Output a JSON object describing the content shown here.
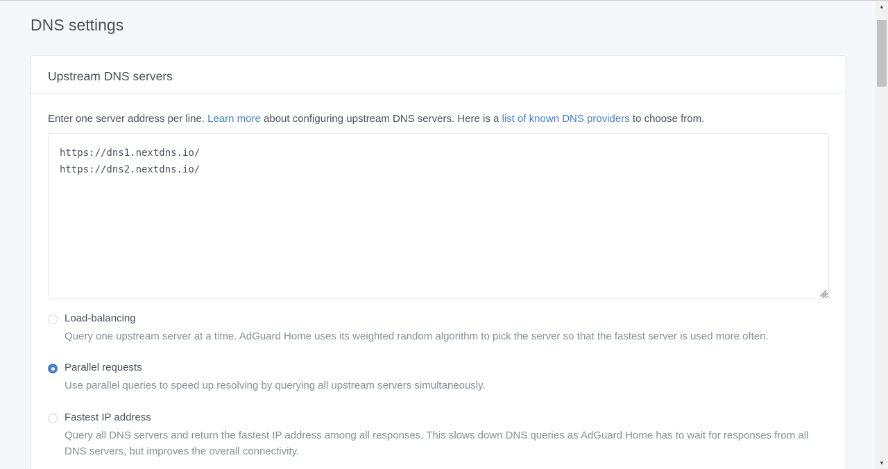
{
  "page": {
    "title": "DNS settings"
  },
  "card": {
    "title": "Upstream DNS servers",
    "description": {
      "before": "Enter one server address per line. ",
      "link1": "Learn more",
      "middle": " about configuring upstream DNS servers. Here is a ",
      "link2": "list of known DNS providers",
      "after": " to choose from."
    },
    "upstreams_value": "https://dns1.nextdns.io/\nhttps://dns2.nextdns.io/",
    "options": [
      {
        "label": "Load-balancing",
        "description": "Query one upstream server at a time. AdGuard Home uses its weighted random algorithm to pick the server so that the fastest server is used more often.",
        "checked": false
      },
      {
        "label": "Parallel requests",
        "description": "Use parallel queries to speed up resolving by querying all upstream servers simultaneously.",
        "checked": true
      },
      {
        "label": "Fastest IP address",
        "description": "Query all DNS servers and return the fastest IP address among all responses. This slows down DNS queries as AdGuard Home has to wait for responses from all DNS servers, but improves the overall connectivity.",
        "checked": false
      }
    ]
  },
  "colors": {
    "link": "#467fcf",
    "radio_checked": "#467fcf",
    "muted_text": "#868e96"
  },
  "icons": {
    "scroll_up": "scroll-up-arrow-icon",
    "scroll_down": "scroll-down-arrow-icon",
    "resize": "resize-grip-icon"
  }
}
